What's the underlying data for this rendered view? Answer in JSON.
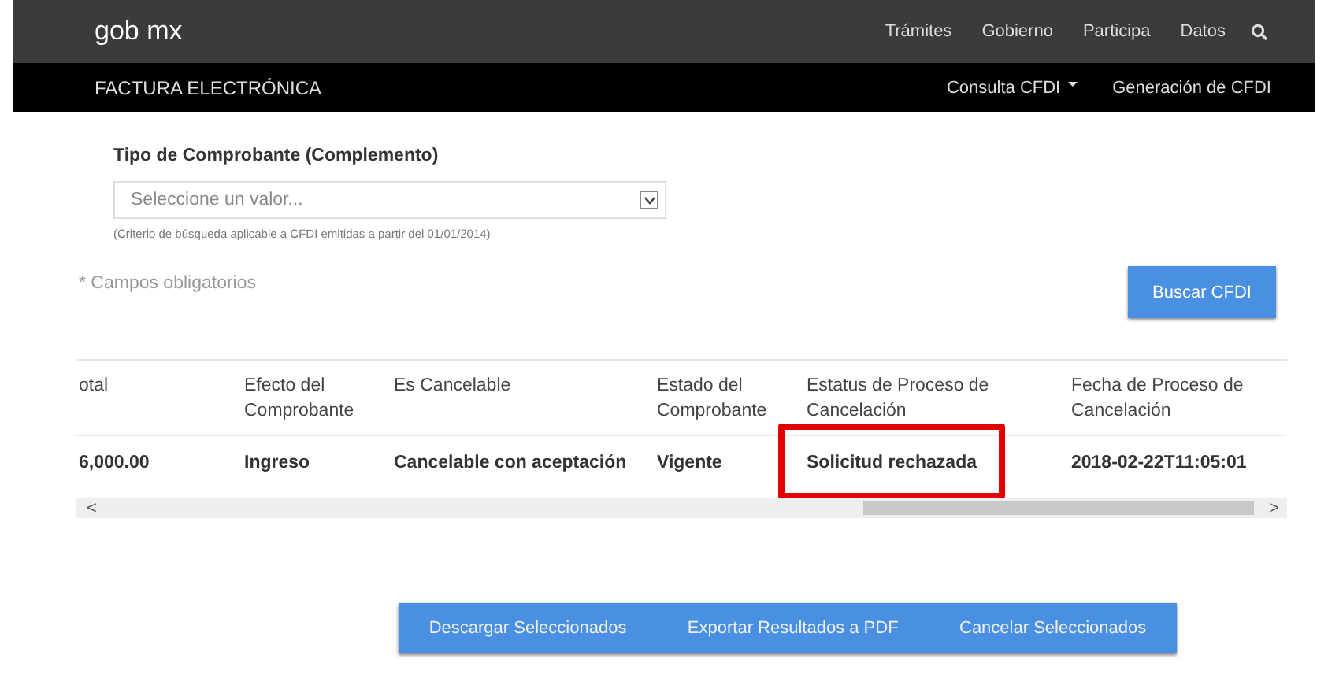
{
  "top_bar": {
    "logo": "gob mx",
    "links": [
      "Trámites",
      "Gobierno",
      "Participa",
      "Datos"
    ],
    "search_icon": true
  },
  "sub_bar": {
    "title": "FACTURA ELECTRÓNICA",
    "links": [
      {
        "label": "Consulta CFDI",
        "dropdown": true
      },
      {
        "label": "Generación de CFDI",
        "dropdown": false
      }
    ]
  },
  "form": {
    "label": "Tipo de Comprobante (Complemento)",
    "select": {
      "placeholder": "Seleccione un valor..."
    },
    "hint": "(Criterio de búsqueda aplicable a CFDI emitidas a partir del 01/01/2014)",
    "required_note": "* Campos obligatorios",
    "search_button": "Buscar CFDI"
  },
  "table": {
    "columns": [
      "otal",
      "Efecto del Comprobante",
      "Es Cancelable",
      "Estado del Comprobante",
      "Estatus de Proceso de Cancelación",
      "Fecha de Proceso de Cancelación"
    ],
    "rows": [
      {
        "cells": [
          {
            "text": "6,000.00",
            "highlighted": false
          },
          {
            "text": "Ingreso",
            "highlighted": false
          },
          {
            "text": "Cancelable con aceptación",
            "highlighted": false
          },
          {
            "text": "Vigente",
            "highlighted": false
          },
          {
            "text": "Solicitud rechazada",
            "highlighted": true
          },
          {
            "text": "2018-02-22T11:05:01",
            "highlighted": false
          }
        ]
      }
    ],
    "scroll_left": "<",
    "scroll_right": ">"
  },
  "actions": [
    "Descargar Seleccionados",
    "Exportar Resultados a PDF",
    "Cancelar Seleccionados"
  ]
}
